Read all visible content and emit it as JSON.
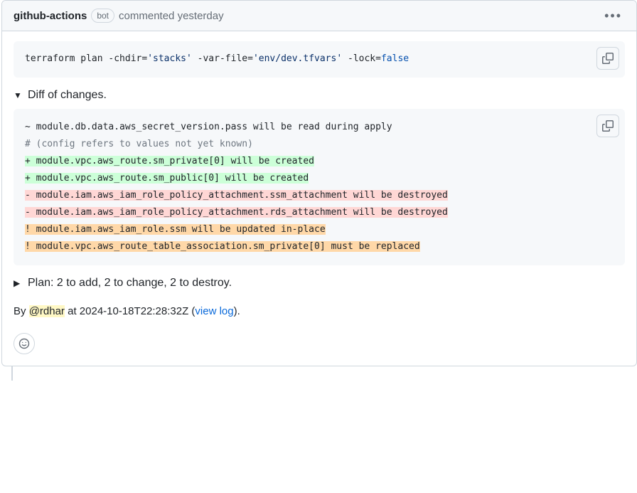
{
  "header": {
    "author": "github-actions",
    "bot_badge": "bot",
    "meta_prefix": "commented ",
    "meta_time": "yesterday"
  },
  "command": {
    "raw": "terraform plan -chdir='stacks' -var-file='env/dev.tfvars' -lock=false",
    "tokens": [
      {
        "t": "terraform plan ",
        "c": "tok-cmd"
      },
      {
        "t": "-chdir=",
        "c": "tok-flag"
      },
      {
        "t": "'stacks'",
        "c": "tok-str"
      },
      {
        "t": " ",
        "c": "tok-cmd"
      },
      {
        "t": "-var-file=",
        "c": "tok-flag"
      },
      {
        "t": "'env/dev.tfvars'",
        "c": "tok-str"
      },
      {
        "t": " ",
        "c": "tok-cmd"
      },
      {
        "t": "-lock=",
        "c": "tok-flag"
      },
      {
        "t": "false",
        "c": "tok-kw"
      }
    ]
  },
  "diff": {
    "title": "Diff of changes.",
    "expanded_marker": "▼",
    "lines": [
      {
        "text": "~ module.db.data.aws_secret_version.pass will be read during apply",
        "kind": "plain"
      },
      {
        "text": "# (config refers to values not yet known)",
        "kind": "comment"
      },
      {
        "text": "+ module.vpc.aws_route.sm_private[0] will be created",
        "kind": "add"
      },
      {
        "text": "+ module.vpc.aws_route.sm_public[0] will be created",
        "kind": "add"
      },
      {
        "text": "- module.iam.aws_iam_role_policy_attachment.ssm_attachment will be destroyed",
        "kind": "del"
      },
      {
        "text": "- module.iam.aws_iam_role_policy_attachment.rds_attachment will be destroyed",
        "kind": "del"
      },
      {
        "text": "! module.iam.aws_iam_role.ssm will be updated in-place",
        "kind": "warn"
      },
      {
        "text": "! module.vpc.aws_route_table_association.sm_private[0] must be replaced",
        "kind": "warn"
      }
    ]
  },
  "plan": {
    "collapsed_marker": "▶",
    "summary": "Plan: 2 to add, 2 to change, 2 to destroy."
  },
  "byline": {
    "by": "By ",
    "mention": "@rdhar",
    "at": " at ",
    "timestamp": "2024-10-18T22:28:32Z",
    "space_paren": " (",
    "view_log_label": "view log",
    "close_paren": ")."
  }
}
